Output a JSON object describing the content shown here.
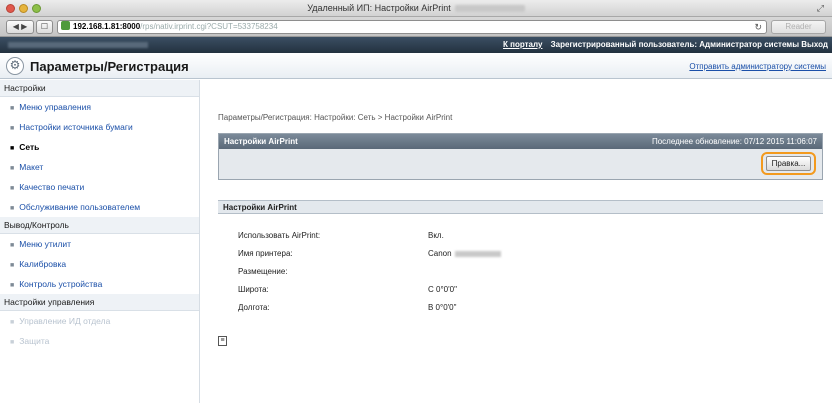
{
  "window": {
    "title": "Удаленный ИП: Настройки AirPrint"
  },
  "toolbar": {
    "back_forward": "◀ ▶",
    "bookmark": "☐",
    "url_host": "192.168.1.81:8000",
    "url_path": "/rps/nativ.irprint.cgi?CSUT=533758234",
    "reader": "Reader"
  },
  "portal": {
    "portal_link": "К порталу",
    "user_text": "Зарегистрированный пользователь: Администратор системы",
    "logout_link": "Выход"
  },
  "header": {
    "title": "Параметры/Регистрация",
    "send_admin": "Отправить администратору системы"
  },
  "sidebar": [
    {
      "type": "category",
      "label": "Настройки"
    },
    {
      "type": "item",
      "label": "Меню управления"
    },
    {
      "type": "item",
      "label": "Настройки источника бумаги"
    },
    {
      "type": "item",
      "label": "Сеть",
      "active": true
    },
    {
      "type": "item",
      "label": "Макет"
    },
    {
      "type": "item",
      "label": "Качество печати"
    },
    {
      "type": "item",
      "label": "Обслуживание пользователем"
    },
    {
      "type": "category",
      "label": "Вывод/Контроль"
    },
    {
      "type": "item",
      "label": "Меню утилит"
    },
    {
      "type": "item",
      "label": "Калибровка"
    },
    {
      "type": "item",
      "label": "Контроль устройства"
    },
    {
      "type": "category",
      "label": "Настройки управления"
    },
    {
      "type": "item",
      "label": "Управление ИД отдела",
      "faded": true
    },
    {
      "type": "item",
      "label": "Защита",
      "faded": true
    }
  ],
  "main": {
    "breadcrumb": "Параметры/Регистрация: Настройки: Сеть > Настройки AirPrint",
    "section_title": "Настройки AirPrint",
    "last_update": "Последнее обновление: 07/12 2015 11:06:07",
    "edit_label": "Правка...",
    "details_title": "Настройки AirPrint",
    "rows": [
      {
        "label": "Использовать AirPrint:",
        "value": "Вкл."
      },
      {
        "label": "Имя принтера:",
        "value": "Canon"
      },
      {
        "label": "Размещение:",
        "value": ""
      },
      {
        "label": "Широта:",
        "value": "С 0°0'0\""
      },
      {
        "label": "Долгота:",
        "value": "В 0°0'0\""
      }
    ]
  }
}
